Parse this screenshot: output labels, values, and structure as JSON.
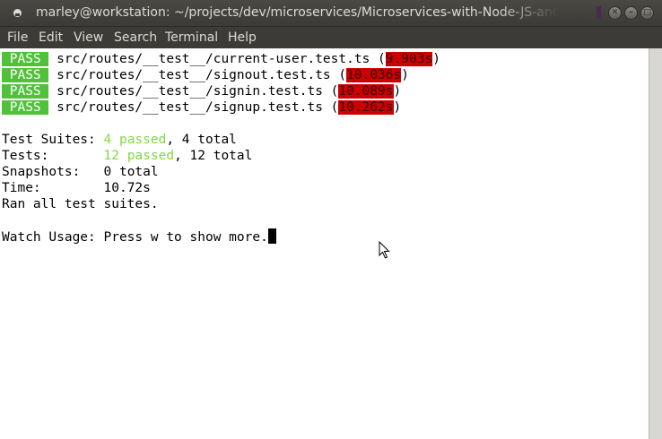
{
  "window": {
    "title": "marley@workstation: ~/projects/dev/microservices/Microservices-with-Node-JS-and"
  },
  "menu": [
    "File",
    "Edit",
    "View",
    "Search",
    "Terminal",
    "Help"
  ],
  "results": [
    {
      "status": "PASS",
      "path": "src/routes/__test__/current-user.test.ts",
      "time": "9.903s"
    },
    {
      "status": "PASS",
      "path": "src/routes/__test__/signout.test.ts",
      "time": "10.036s"
    },
    {
      "status": "PASS",
      "path": "src/routes/__test__/signin.test.ts",
      "time": "10.089s"
    },
    {
      "status": "PASS",
      "path": "src/routes/__test__/signup.test.ts",
      "time": "10.262s"
    }
  ],
  "summary": {
    "suites_label": "Test Suites: ",
    "suites_passed": "4 passed",
    "suites_total": ", 4 total",
    "tests_label": "Tests:       ",
    "tests_passed": "12 passed",
    "tests_total": ", 12 total",
    "snapshots_label": "Snapshots:   ",
    "snapshots_value": "0 total",
    "time_label": "Time:        ",
    "time_value": "10.72s",
    "ran": "Ran all test suites."
  },
  "watch": "Watch Usage: Press w to show more.",
  "colors": {
    "pass_bg": "#4fc23a",
    "slow_bg": "#cc0000",
    "passed_text": "#7fd943",
    "titlebar": "#3c3b37"
  }
}
